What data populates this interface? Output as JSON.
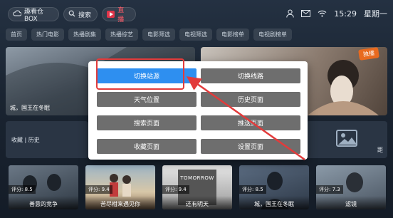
{
  "topbar": {
    "brand_label": "趣看仓BOX",
    "search_label": "搜索",
    "live_label": "直播",
    "time": "15:29",
    "weekday": "星期一",
    "icons": [
      "user-icon",
      "mail-icon",
      "wifi-icon"
    ]
  },
  "chips": [
    "首页",
    "热门电影",
    "热播剧集",
    "热播综艺",
    "电影筛选",
    "电视筛选",
    "电影榜单",
    "电视剧榜单"
  ],
  "hero": {
    "left_caption": "城，国王在冬眠",
    "right_tag": "独播"
  },
  "row2": {
    "left_label": "收藏 | 历史",
    "right_fragment": "距"
  },
  "posters": [
    {
      "score": "评分: 8.5",
      "title": "善意的竞争"
    },
    {
      "score": "评分: 9.4",
      "title": "苦尽柑来遇见你"
    },
    {
      "score": "评分: 9.4",
      "title": "还有明天",
      "overlay_text": "TOMORROW"
    },
    {
      "score": "评分: 8.5",
      "title": "城，国王在冬眠"
    },
    {
      "score": "评分: 7.3",
      "title": "滤镜"
    }
  ],
  "menu": {
    "items": [
      {
        "label": "切换站源",
        "active": true
      },
      {
        "label": "切换线路",
        "active": false
      },
      {
        "label": "天气位置",
        "active": false
      },
      {
        "label": "历史页面",
        "active": false
      },
      {
        "label": "搜索页面",
        "active": false
      },
      {
        "label": "推送页面",
        "active": false
      },
      {
        "label": "收藏页面",
        "active": false
      },
      {
        "label": "设置页面",
        "active": false
      }
    ]
  },
  "colors": {
    "accent_blue": "#2e8ff0",
    "menu_button_gray": "#6e6e6e",
    "annotation_red": "#e23b3b",
    "live_red": "#e0354a"
  }
}
